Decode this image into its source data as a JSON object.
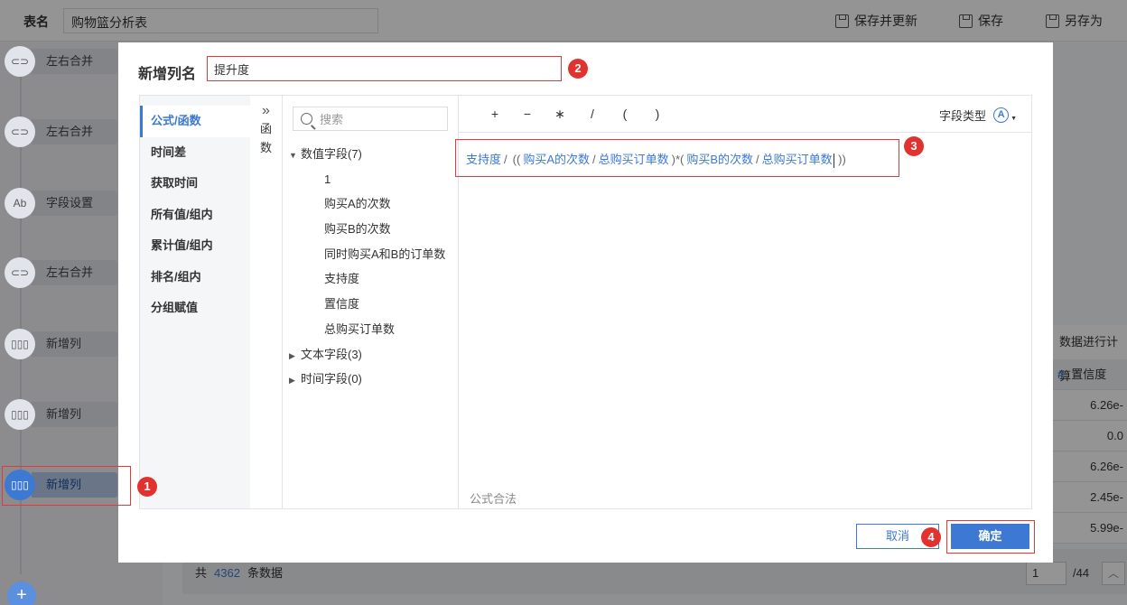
{
  "topbar": {
    "table_name_label": "表名",
    "table_name_value": "购物篮分析表",
    "save_update": "保存并更新",
    "save": "保存",
    "save_as": "另存为"
  },
  "steps": [
    {
      "label": "左右合并",
      "icon": "link-icon"
    },
    {
      "label": "左右合并",
      "icon": "link-icon"
    },
    {
      "label": "字段设置",
      "icon": "ab-icon"
    },
    {
      "label": "左右合并",
      "icon": "link-icon"
    },
    {
      "label": "新增列",
      "icon": "columns-icon"
    },
    {
      "label": "新增列",
      "icon": "columns-icon"
    },
    {
      "label": "新增列",
      "icon": "columns-icon",
      "active": true
    }
  ],
  "right_table": {
    "note": "数据进行计算",
    "header": "置信度",
    "values": [
      "6.26e-",
      "0.0",
      "6.26e-",
      "2.45e-",
      "5.99e-"
    ]
  },
  "footer": {
    "prefix": "共",
    "count": "4362",
    "suffix": "条数据",
    "page": "1",
    "total": "/44"
  },
  "dialog": {
    "title": "新增列名",
    "name_value": "提升度",
    "nav": [
      "公式/函数",
      "时间差",
      "获取时间",
      "所有值/组内",
      "累计值/组内",
      "排名/组内",
      "分组赋值"
    ],
    "func_chars": [
      "函",
      "数"
    ],
    "search_placeholder": "搜索",
    "tree": {
      "numeric_group": "数值字段(7)",
      "numeric_fields": [
        "1",
        "购买A的次数",
        "购买B的次数",
        "同时购买A和B的订单数",
        "支持度",
        "置信度",
        "总购买订单数"
      ],
      "text_group": "文本字段(3)",
      "time_group": "时间字段(0)"
    },
    "ops": [
      "+",
      "−",
      "∗",
      "/",
      "(",
      ")"
    ],
    "field_type": "字段类型",
    "field_type_icon": "A",
    "formula": {
      "f1": "支持度",
      "op1": "/",
      "paren1": "((",
      "f2": "购买A的次数",
      "op2": "/",
      "f3": "总购买订单数",
      "close1": ")*(",
      "f4": "购买B的次数",
      "op3": "/",
      "f5": "总购买订单数",
      "close2": "))"
    },
    "status": "公式合法",
    "cancel": "取消",
    "confirm": "确定"
  },
  "badges": [
    "1",
    "2",
    "3",
    "4"
  ],
  "accent": "#3d79d2",
  "highlight": "#e03a3a"
}
